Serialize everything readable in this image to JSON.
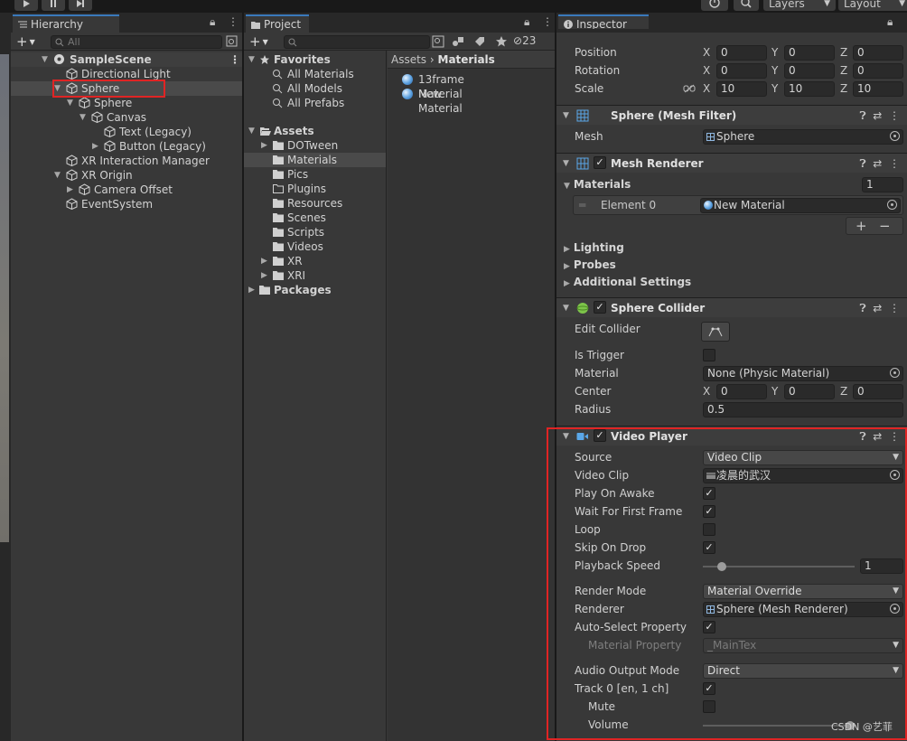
{
  "toolbar": {
    "layers_label": "Layers",
    "layout_label": "Layout"
  },
  "hierarchy": {
    "tab_label": "Hierarchy",
    "search_placeholder": "All",
    "items": [
      {
        "label": "SampleScene",
        "kind": "scene"
      },
      {
        "label": "Directional Light"
      },
      {
        "label": "Sphere",
        "selected": true
      },
      {
        "label": "Sphere"
      },
      {
        "label": "Canvas"
      },
      {
        "label": "Text (Legacy)"
      },
      {
        "label": "Button (Legacy)"
      },
      {
        "label": "XR Interaction Manager"
      },
      {
        "label": "XR Origin"
      },
      {
        "label": "Camera Offset"
      },
      {
        "label": "EventSystem"
      }
    ]
  },
  "project": {
    "tab_label": "Project",
    "hidden_count": "23",
    "tree": [
      {
        "label": "Favorites",
        "bold": true
      },
      {
        "label": "All Materials"
      },
      {
        "label": "All Models"
      },
      {
        "label": "All Prefabs"
      },
      {
        "label": "Assets",
        "bold": true
      },
      {
        "label": "DOTween"
      },
      {
        "label": "Materials",
        "selected": true
      },
      {
        "label": "Pics"
      },
      {
        "label": "Plugins"
      },
      {
        "label": "Resources"
      },
      {
        "label": "Scenes"
      },
      {
        "label": "Scripts"
      },
      {
        "label": "Videos"
      },
      {
        "label": "XR"
      },
      {
        "label": "XRI"
      },
      {
        "label": "Packages",
        "bold": true
      }
    ],
    "breadcrumb": {
      "root": "Assets",
      "current": "Materials"
    },
    "files": [
      "13frame Material",
      "New Material"
    ]
  },
  "inspector": {
    "tab_label": "Inspector",
    "transform": {
      "position_label": "Position",
      "rotation_label": "Rotation",
      "scale_label": "Scale",
      "position": {
        "x": "0",
        "y": "0",
        "z": "0"
      },
      "rotation": {
        "x": "0",
        "y": "0",
        "z": "0"
      },
      "scale": {
        "x": "10",
        "y": "10",
        "z": "10"
      }
    },
    "axis": {
      "x": "X",
      "y": "Y",
      "z": "Z"
    },
    "mesh_filter": {
      "title": "Sphere (Mesh Filter)",
      "mesh_label": "Mesh",
      "mesh_value": "Sphere"
    },
    "mesh_renderer": {
      "title": "Mesh Renderer",
      "materials_label": "Materials",
      "materials_count": "1",
      "element_label": "Element 0",
      "element_value": "New Material",
      "add_label": "+",
      "remove_label": "−",
      "lighting_label": "Lighting",
      "probes_label": "Probes",
      "additional_label": "Additional Settings"
    },
    "sphere_collider": {
      "title": "Sphere Collider",
      "edit_label": "Edit Collider",
      "trigger_label": "Is Trigger",
      "material_label": "Material",
      "material_value": "None (Physic Material)",
      "center_label": "Center",
      "center": {
        "x": "0",
        "y": "0",
        "z": "0"
      },
      "radius_label": "Radius",
      "radius_value": "0.5"
    },
    "video_player": {
      "title": "Video Player",
      "source_label": "Source",
      "source_value": "Video Clip",
      "clip_label": "Video Clip",
      "clip_value": "凌晨的武汉",
      "play_on_awake_label": "Play On Awake",
      "wait_label": "Wait For First Frame",
      "loop_label": "Loop",
      "skip_label": "Skip On Drop",
      "speed_label": "Playback Speed",
      "speed_value": "1",
      "render_mode_label": "Render Mode",
      "render_mode_value": "Material Override",
      "renderer_label": "Renderer",
      "renderer_value": "Sphere (Mesh Renderer)",
      "auto_select_label": "Auto-Select Property",
      "material_property_label": "Material Property",
      "material_property_value": "_MainTex",
      "audio_mode_label": "Audio Output Mode",
      "audio_mode_value": "Direct",
      "track_label": "Track 0 [en, 1 ch]",
      "mute_label": "Mute",
      "volume_label": "Volume"
    }
  },
  "watermark": "CSDN @艺菲",
  "colors": {
    "accent": "#3a79bb",
    "highlight_box": "#e02424",
    "panel": "#383838"
  }
}
